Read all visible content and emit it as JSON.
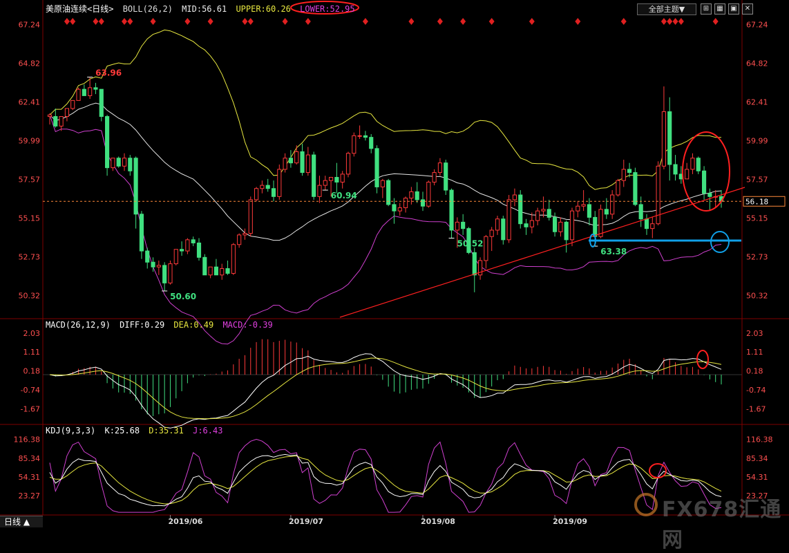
{
  "header": {
    "title": "美原油连续<日线>",
    "boll_label": "BOLL(26,2)",
    "mid": "MID:56.61",
    "upper": "UPPER:60.26",
    "lower": "LOWER:52.95",
    "theme_button": "全部主题▼",
    "period_button": "日线 ▲"
  },
  "watermark": "FX678汇通网",
  "colors": {
    "up": "#ff3a3a",
    "down": "#40e080",
    "mid": "#e6e6e6",
    "upper": "#e8e840",
    "lower": "#d040d0",
    "axis_text": "#ff5050",
    "grid": "#800000",
    "annot_red": "#ff2020",
    "annot_blue": "#10a0e8"
  },
  "chart_data": [
    {
      "type": "candlestick",
      "title": "美原油连续<日线>",
      "ylim": [
        49.0,
        68.0
      ],
      "yticks": [
        67.24,
        64.82,
        62.41,
        59.99,
        57.57,
        55.15,
        52.73,
        50.32
      ],
      "xticks": [
        {
          "label": "2019/06",
          "index": 21
        },
        {
          "label": "2019/07",
          "index": 42
        },
        {
          "label": "2019/08",
          "index": 65
        },
        {
          "label": "2019/09",
          "index": 88
        }
      ],
      "current_price": "56.18",
      "annotations": [
        {
          "label": "63.96",
          "index": 7
        },
        {
          "label": "50.60",
          "index": 20
        },
        {
          "label": "60.94",
          "index": 48
        },
        {
          "label": "50.52",
          "index": 70
        },
        {
          "label": "63.38",
          "index": 95
        }
      ],
      "ohlc": [
        [
          61.5,
          61.7,
          61.0,
          61.6
        ],
        [
          61.5,
          62.0,
          60.8,
          60.9
        ],
        [
          60.9,
          61.5,
          60.6,
          61.5
        ],
        [
          61.5,
          62.0,
          61.2,
          62.0
        ],
        [
          62.0,
          62.5,
          61.9,
          62.5
        ],
        [
          62.5,
          63.3,
          62.5,
          63.2
        ],
        [
          63.2,
          63.5,
          62.8,
          62.8
        ],
        [
          62.8,
          63.96,
          62.6,
          63.3
        ],
        [
          63.3,
          63.6,
          62.9,
          63.2
        ],
        [
          63.2,
          63.2,
          61.2,
          61.5
        ],
        [
          61.5,
          61.6,
          57.8,
          58.3
        ],
        [
          58.3,
          58.9,
          58.1,
          58.9
        ],
        [
          58.9,
          59.0,
          58.3,
          58.4
        ],
        [
          58.4,
          59.2,
          58.1,
          58.9
        ],
        [
          58.9,
          59.1,
          57.8,
          58.1
        ],
        [
          58.9,
          59.0,
          54.5,
          55.4
        ],
        [
          55.4,
          55.6,
          52.6,
          53.1
        ],
        [
          53.1,
          53.3,
          52.0,
          52.4
        ],
        [
          52.4,
          52.7,
          51.8,
          52.1
        ],
        [
          52.1,
          52.5,
          51.6,
          52.2
        ],
        [
          52.2,
          52.4,
          50.6,
          51.1
        ],
        [
          51.1,
          52.5,
          51.0,
          52.3
        ],
        [
          52.3,
          53.2,
          52.2,
          53.2
        ],
        [
          53.2,
          53.7,
          52.8,
          53.1
        ],
        [
          53.1,
          53.9,
          52.9,
          53.8
        ],
        [
          53.8,
          54.0,
          53.4,
          53.6
        ],
        [
          53.6,
          53.9,
          52.5,
          52.7
        ],
        [
          52.7,
          52.9,
          51.6,
          51.6
        ],
        [
          51.6,
          52.1,
          51.4,
          52.1
        ],
        [
          52.1,
          52.6,
          51.6,
          51.6
        ],
        [
          51.6,
          52.3,
          51.3,
          52.0
        ],
        [
          52.0,
          52.5,
          51.6,
          51.7
        ],
        [
          51.7,
          53.6,
          51.6,
          53.5
        ],
        [
          53.5,
          54.2,
          53.3,
          54.1
        ],
        [
          54.1,
          54.5,
          53.8,
          54.2
        ],
        [
          54.2,
          56.5,
          54.0,
          56.3
        ],
        [
          56.3,
          57.1,
          56.2,
          57.0
        ],
        [
          57.0,
          57.5,
          56.7,
          57.2
        ],
        [
          57.2,
          57.6,
          56.8,
          57.0
        ],
        [
          57.0,
          57.5,
          56.2,
          56.5
        ],
        [
          56.5,
          58.5,
          56.3,
          58.2
        ],
        [
          58.2,
          59.2,
          58.0,
          58.9
        ],
        [
          58.9,
          59.4,
          58.3,
          58.6
        ],
        [
          58.6,
          59.7,
          58.5,
          59.3
        ],
        [
          59.3,
          59.8,
          57.8,
          58.0
        ],
        [
          58.0,
          59.6,
          57.8,
          59.1
        ],
        [
          59.1,
          59.3,
          56.3,
          56.5
        ],
        [
          56.5,
          57.8,
          56.1,
          57.2
        ],
        [
          57.2,
          57.8,
          56.9,
          57.5
        ],
        [
          57.5,
          57.7,
          56.5,
          57.7
        ],
        [
          57.7,
          58.6,
          56.7,
          57.4
        ],
        [
          57.4,
          58.1,
          57.0,
          57.9
        ],
        [
          57.9,
          59.3,
          57.7,
          59.2
        ],
        [
          59.2,
          60.5,
          59.0,
          60.3
        ],
        [
          60.3,
          60.94,
          60.1,
          60.3
        ],
        [
          60.3,
          60.6,
          60.0,
          60.2
        ],
        [
          60.2,
          60.4,
          59.2,
          59.5
        ],
        [
          59.5,
          59.7,
          56.7,
          57.1
        ],
        [
          57.1,
          57.6,
          56.4,
          57.5
        ],
        [
          57.5,
          57.6,
          55.9,
          56.0
        ],
        [
          56.0,
          56.4,
          54.8,
          55.6
        ],
        [
          55.6,
          56.1,
          55.3,
          55.8
        ],
        [
          55.8,
          56.5,
          55.5,
          56.4
        ],
        [
          56.4,
          57.1,
          56.0,
          56.8
        ],
        [
          56.8,
          57.4,
          56.1,
          56.3
        ],
        [
          56.3,
          56.8,
          55.6,
          55.9
        ],
        [
          55.9,
          57.5,
          55.8,
          57.4
        ],
        [
          57.4,
          58.2,
          57.2,
          58.0
        ],
        [
          58.0,
          58.9,
          57.8,
          58.6
        ],
        [
          58.6,
          58.8,
          56.6,
          56.9
        ],
        [
          56.9,
          57.0,
          53.9,
          54.4
        ],
        [
          54.4,
          55.2,
          53.3,
          54.9
        ],
        [
          54.9,
          55.4,
          54.1,
          54.5
        ],
        [
          54.5,
          54.6,
          52.9,
          53.0
        ],
        [
          53.0,
          53.3,
          50.52,
          51.6
        ],
        [
          51.6,
          52.7,
          51.3,
          52.5
        ],
        [
          52.5,
          54.1,
          52.0,
          54.0
        ],
        [
          54.0,
          54.6,
          53.1,
          54.4
        ],
        [
          54.4,
          55.3,
          54.1,
          55.1
        ],
        [
          55.1,
          55.3,
          53.5,
          53.8
        ],
        [
          53.8,
          56.6,
          53.6,
          56.3
        ],
        [
          56.3,
          57.0,
          55.9,
          56.6
        ],
        [
          56.6,
          56.9,
          54.5,
          54.8
        ],
        [
          54.8,
          55.1,
          54.1,
          54.6
        ],
        [
          54.6,
          55.5,
          54.2,
          55.0
        ],
        [
          55.0,
          55.8,
          54.7,
          55.6
        ],
        [
          55.6,
          56.5,
          55.2,
          55.7
        ],
        [
          55.7,
          56.3,
          55.0,
          55.2
        ],
        [
          55.2,
          55.5,
          54.0,
          54.3
        ],
        [
          54.3,
          55.2,
          54.0,
          54.9
        ],
        [
          54.9,
          55.0,
          53.0,
          53.8
        ],
        [
          53.8,
          55.8,
          53.4,
          55.6
        ],
        [
          55.6,
          56.2,
          55.2,
          55.9
        ],
        [
          55.9,
          56.9,
          55.6,
          56.0
        ],
        [
          56.0,
          56.4,
          54.7,
          55.2
        ],
        [
          55.2,
          55.6,
          53.4,
          54.0
        ],
        [
          54.0,
          56.0,
          53.9,
          55.7
        ],
        [
          55.7,
          56.4,
          55.1,
          55.4
        ],
        [
          55.4,
          56.9,
          55.1,
          56.6
        ],
        [
          56.6,
          57.6,
          56.5,
          57.5
        ],
        [
          57.5,
          58.8,
          57.1,
          58.2
        ],
        [
          58.2,
          58.6,
          57.7,
          58.0
        ],
        [
          58.0,
          58.3,
          55.9,
          56.0
        ],
        [
          56.0,
          56.5,
          54.6,
          55.1
        ],
        [
          55.1,
          55.4,
          54.1,
          54.5
        ],
        [
          54.5,
          55.2,
          53.9,
          54.8
        ],
        [
          54.8,
          58.7,
          54.7,
          58.4
        ],
        [
          58.4,
          63.38,
          58.2,
          61.8
        ],
        [
          61.8,
          62.7,
          57.5,
          58.5
        ],
        [
          58.5,
          59.1,
          57.5,
          57.9
        ],
        [
          57.9,
          58.4,
          57.3,
          57.6
        ],
        [
          57.6,
          58.6,
          57.6,
          58.2
        ],
        [
          58.2,
          59.2,
          57.9,
          58.9
        ],
        [
          58.9,
          59.0,
          57.9,
          58.1
        ],
        [
          58.1,
          58.4,
          56.3,
          56.7
        ],
        [
          56.7,
          57.0,
          55.6,
          56.5
        ],
        [
          56.5,
          56.9,
          55.8,
          56.5
        ],
        [
          56.5,
          56.9,
          55.8,
          56.2
        ]
      ]
    },
    {
      "type": "macd",
      "title": "MACD(26,12,9)",
      "diff_label": "DIFF:0.29",
      "dea_label": "DEA:0.49",
      "macd_label": "MACD:-0.39",
      "ylim": [
        -2.3,
        2.3
      ],
      "yticks": [
        2.03,
        1.11,
        0.18,
        -0.74,
        -1.67
      ]
    },
    {
      "type": "kdj",
      "title": "KDJ(9,3,3)",
      "k_label": "K:25.68",
      "d_label": "D:35.31",
      "j_label": "J:6.43",
      "ylim": [
        -5,
        125
      ],
      "yticks": [
        116.38,
        85.34,
        54.31,
        23.27
      ]
    }
  ]
}
